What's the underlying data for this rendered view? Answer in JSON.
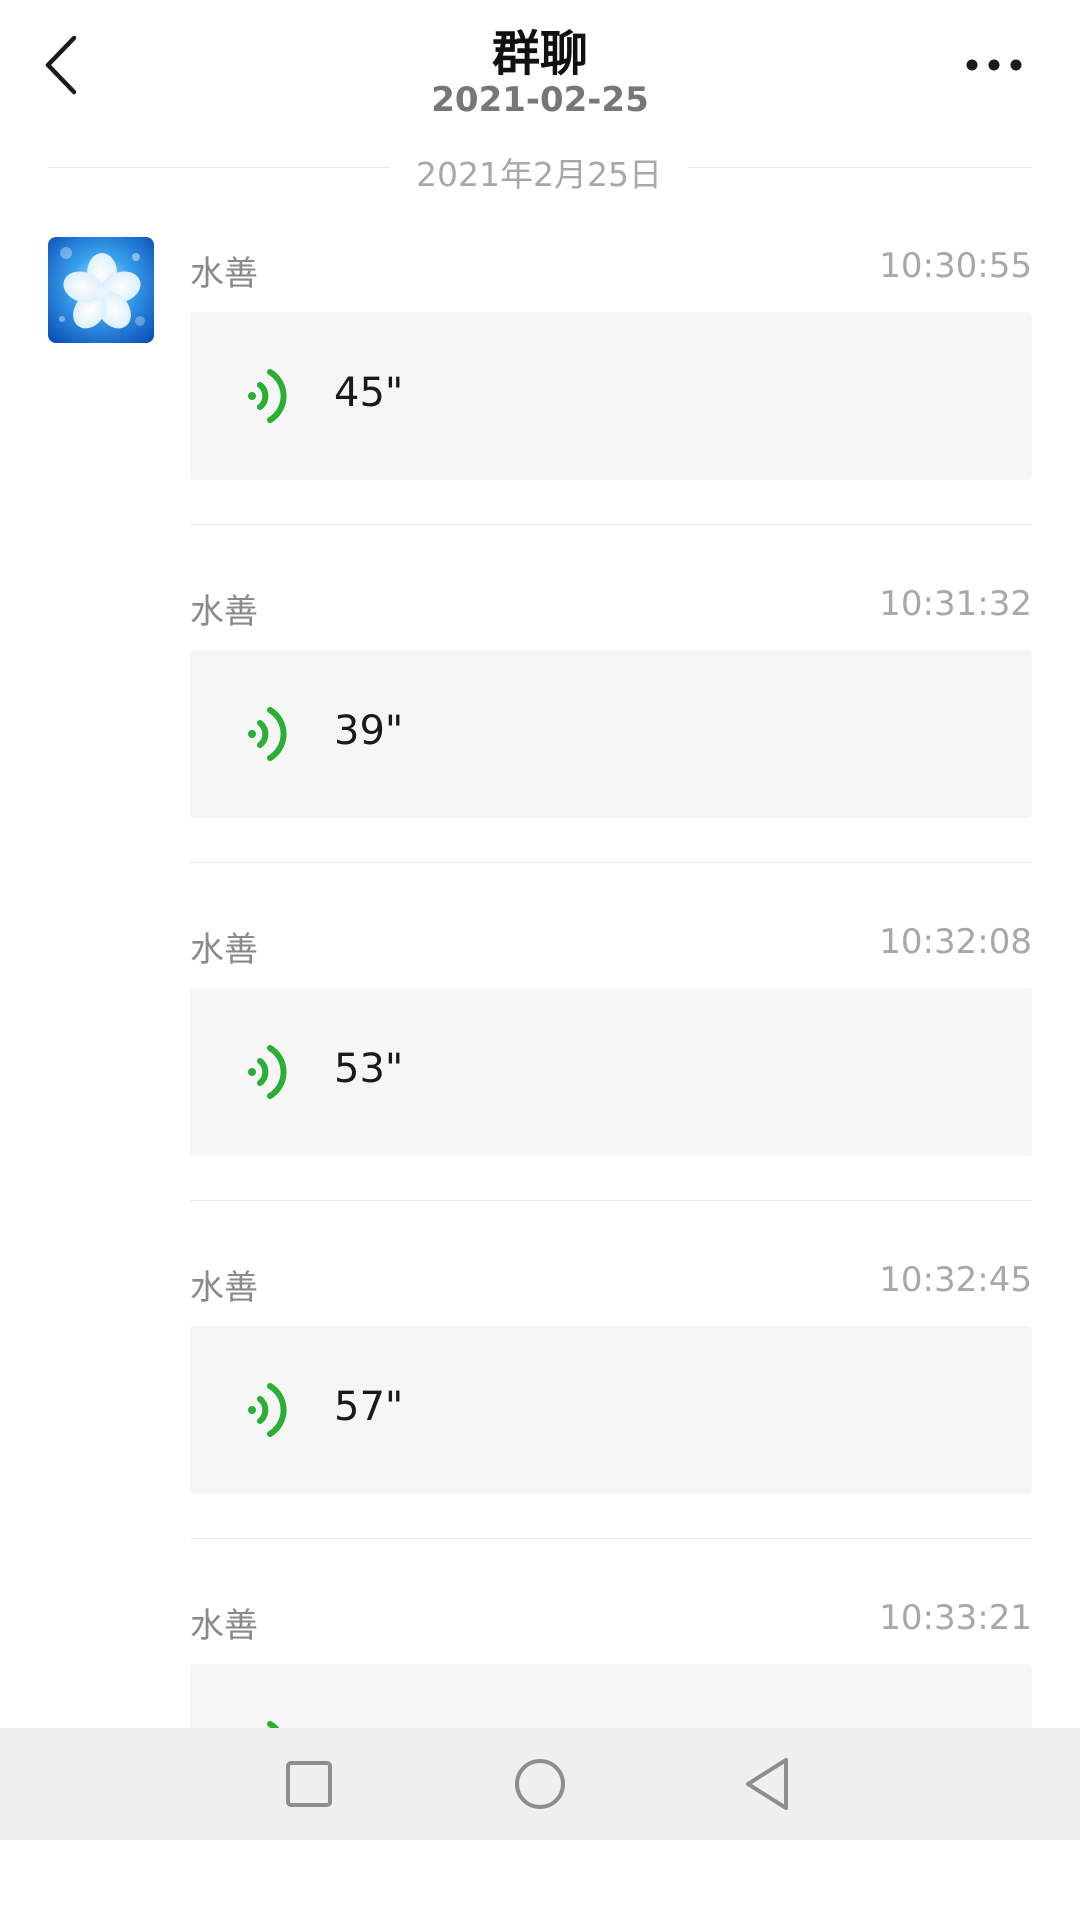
{
  "header": {
    "title": "群聊",
    "subtitle": "2021-02-25"
  },
  "date_separator": "2021年2月25日",
  "messages": [
    {
      "sender": "水善",
      "time": "10:30:55",
      "duration": "45\""
    },
    {
      "sender": "水善",
      "time": "10:31:32",
      "duration": "39\""
    },
    {
      "sender": "水善",
      "time": "10:32:08",
      "duration": "53\""
    },
    {
      "sender": "水善",
      "time": "10:32:45",
      "duration": "57\""
    },
    {
      "sender": "水善",
      "time": "10:33:21",
      "duration": ""
    }
  ],
  "icons": {
    "back": "back-arrow-icon",
    "more": "more-dots-icon",
    "voice": "voice-wave-icon",
    "avatar": "flower-avatar",
    "nav_recents": "square-icon",
    "nav_home": "circle-icon",
    "nav_back": "triangle-back-icon"
  },
  "colors": {
    "voice_accent": "#2aae34",
    "bubble_bg": "#f6f6f6",
    "navbar_bg": "#efefef"
  }
}
